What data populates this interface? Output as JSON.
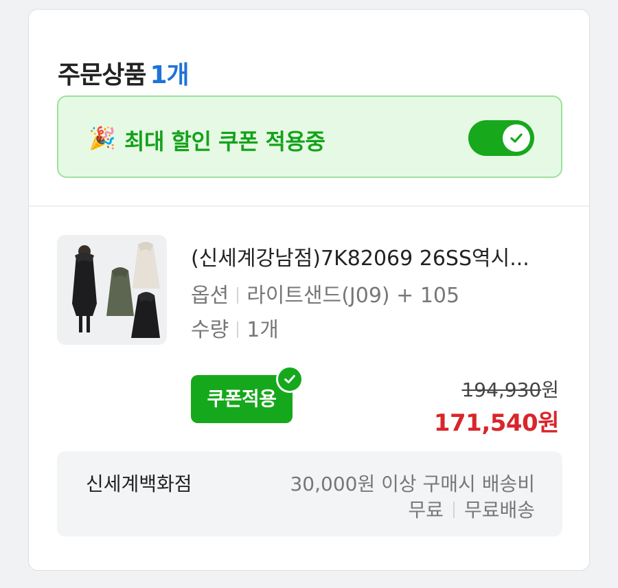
{
  "order": {
    "title": "주문상품",
    "count": "1개"
  },
  "coupon_banner": {
    "icon": "party-popper-icon",
    "emoji": "🎉",
    "text": "최대 할인 쿠폰 적용중",
    "toggle_on": true,
    "accent_color": "#17a81c"
  },
  "product": {
    "name": "(신세계강남점)7K82069 26SS역시...",
    "option_label": "옵션",
    "option_value": "라이트샌드(J09) + 105",
    "qty_label": "수량",
    "qty_value": "1개",
    "coupon_button": "쿠폰적용",
    "original_price": "194,930",
    "original_unit": "원",
    "sale_price": "171,540원",
    "sale_color": "#d8262b"
  },
  "shipping": {
    "seller": "신세계백화점",
    "condition": "30,000원 이상 구매시 배송비",
    "fee_label": "무료",
    "fee_type": "무료배송"
  }
}
